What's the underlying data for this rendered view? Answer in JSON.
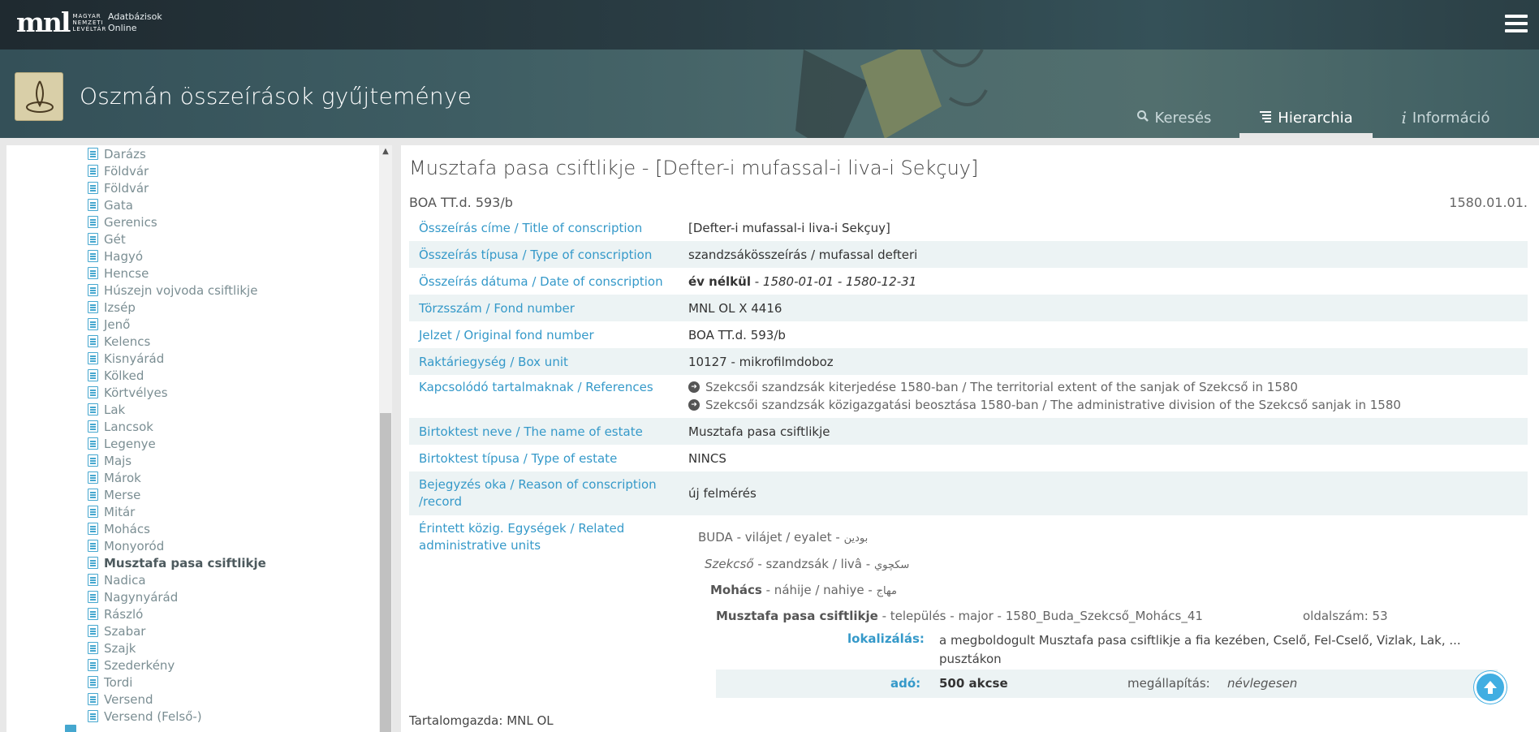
{
  "header": {
    "logo_mark": "mnl",
    "logo_text": "Magyar Nemzeti Levéltár",
    "subtitle_line1": "Adatbázisok",
    "subtitle_line2": "Online"
  },
  "banner": {
    "title": "Oszmán összeírások gyűjteménye"
  },
  "tabs": [
    {
      "label": "Keresés",
      "icon": "search-icon"
    },
    {
      "label": "Hierarchia",
      "icon": "list-icon",
      "active": true
    },
    {
      "label": "Információ",
      "icon": "info-icon"
    }
  ],
  "sidebar": {
    "items": [
      "Darázs",
      "Földvár",
      "Földvár",
      "Gata",
      "Gerenics",
      "Gét",
      "Hagyó",
      "Hencse",
      "Húszejn vojvoda csiftlikje",
      "Izsép",
      "Jenő",
      "Kelencs",
      "Kisnyárád",
      "Kölked",
      "Körtvélyes",
      "Lak",
      "Lancsok",
      "Legenye",
      "Majs",
      "Márok",
      "Merse",
      "Mitár",
      "Mohács",
      "Monyoród",
      "Musztafa pasa csiftlikje",
      "Nadica",
      "Nagynyárád",
      "Rászló",
      "Szabar",
      "Szajk",
      "Szederkény",
      "Tordi",
      "Versend",
      "Versend (Felső-)"
    ],
    "selected": "Musztafa pasa csiftlikje"
  },
  "record": {
    "title": "Musztafa pasa csiftlikje - [Defter-i mufassal-i liva-i Sekçuy]",
    "signature": "BOA TT.d. 593/b",
    "date": "1580.01.01.",
    "fields": {
      "title_label": "Összeírás címe / Title of conscription",
      "title_value": "[Defter-i mufassal-i liva-i Sekçuy]",
      "type_label": "Összeírás típusa / Type of conscription",
      "type_value": "szandzsákösszeírás / mufassal defteri",
      "date_label": "Összeírás dátuma / Date of conscription",
      "date_value_bold": "év nélkül",
      "date_value_sep": " - ",
      "date_value_range": "1580-01-01 - 1580-12-31",
      "fond_label": "Törzsszám / Fond number",
      "fond_value": "MNL OL X 4416",
      "orig_label": "Jelzet / Original fond number",
      "orig_value": "BOA TT.d. 593/b",
      "box_label": "Raktáriegység / Box unit",
      "box_value": "10127 - mikrofilmdoboz",
      "refs_label": "Kapcsolódó tartalmaknak / References",
      "refs": [
        "Szekcsői szandzsák kiterjedése 1580-ban / The territorial extent of the sanjak of Szekcső in 1580",
        "Szekcsői szandzsák közigazgatási beosztása 1580-ban / The administrative division of the Szekcső sanjak in 1580"
      ],
      "estate_label": "Birtoktest neve / The name of estate",
      "estate_value": "Musztafa pasa csiftlikje",
      "estate_type_label": "Birtoktest típusa / Type of estate",
      "estate_type_value": "NINCS",
      "reason_label": "Bejegyzés oka / Reason of conscription /record",
      "reason_value": "új felmérés",
      "units_label": "Érintett közig. Egységek / Related administrative units"
    },
    "units": {
      "l1_name": "BUDA",
      "l1_rest": " - vilájet / eyalet - ",
      "l1_arabic": "بودين",
      "l2_name": "Szekcső",
      "l2_rest": " - szandzsák / livâ - ",
      "l2_arabic": "سکچوي",
      "l3_name": "Mohács",
      "l3_rest": " - náhije / nahiye - ",
      "l3_arabic": "مهاج",
      "l4_name": "Musztafa pasa csiftlikje",
      "l4_rest": " - település - major - 1580_Buda_Szekcső_Mohács_41",
      "page_no": "oldalszám: 53",
      "loc_label": "lokalizálás:",
      "loc_value": "a megboldogult Musztafa pasa csiftlikje a fia kezében, Cselő, Fel-Cselő, Vizlak, Lak, ... pusztákon",
      "tax_label": "adó:",
      "tax_value": "500 akcse",
      "finding_label": "megállapítás:",
      "finding_value": "névlegesen"
    },
    "owner": "Tartalomgazda: MNL OL"
  },
  "colors": {
    "accent": "#3599c9",
    "row_alt": "#ecf3f4",
    "back_to_top": "#41aee2"
  }
}
